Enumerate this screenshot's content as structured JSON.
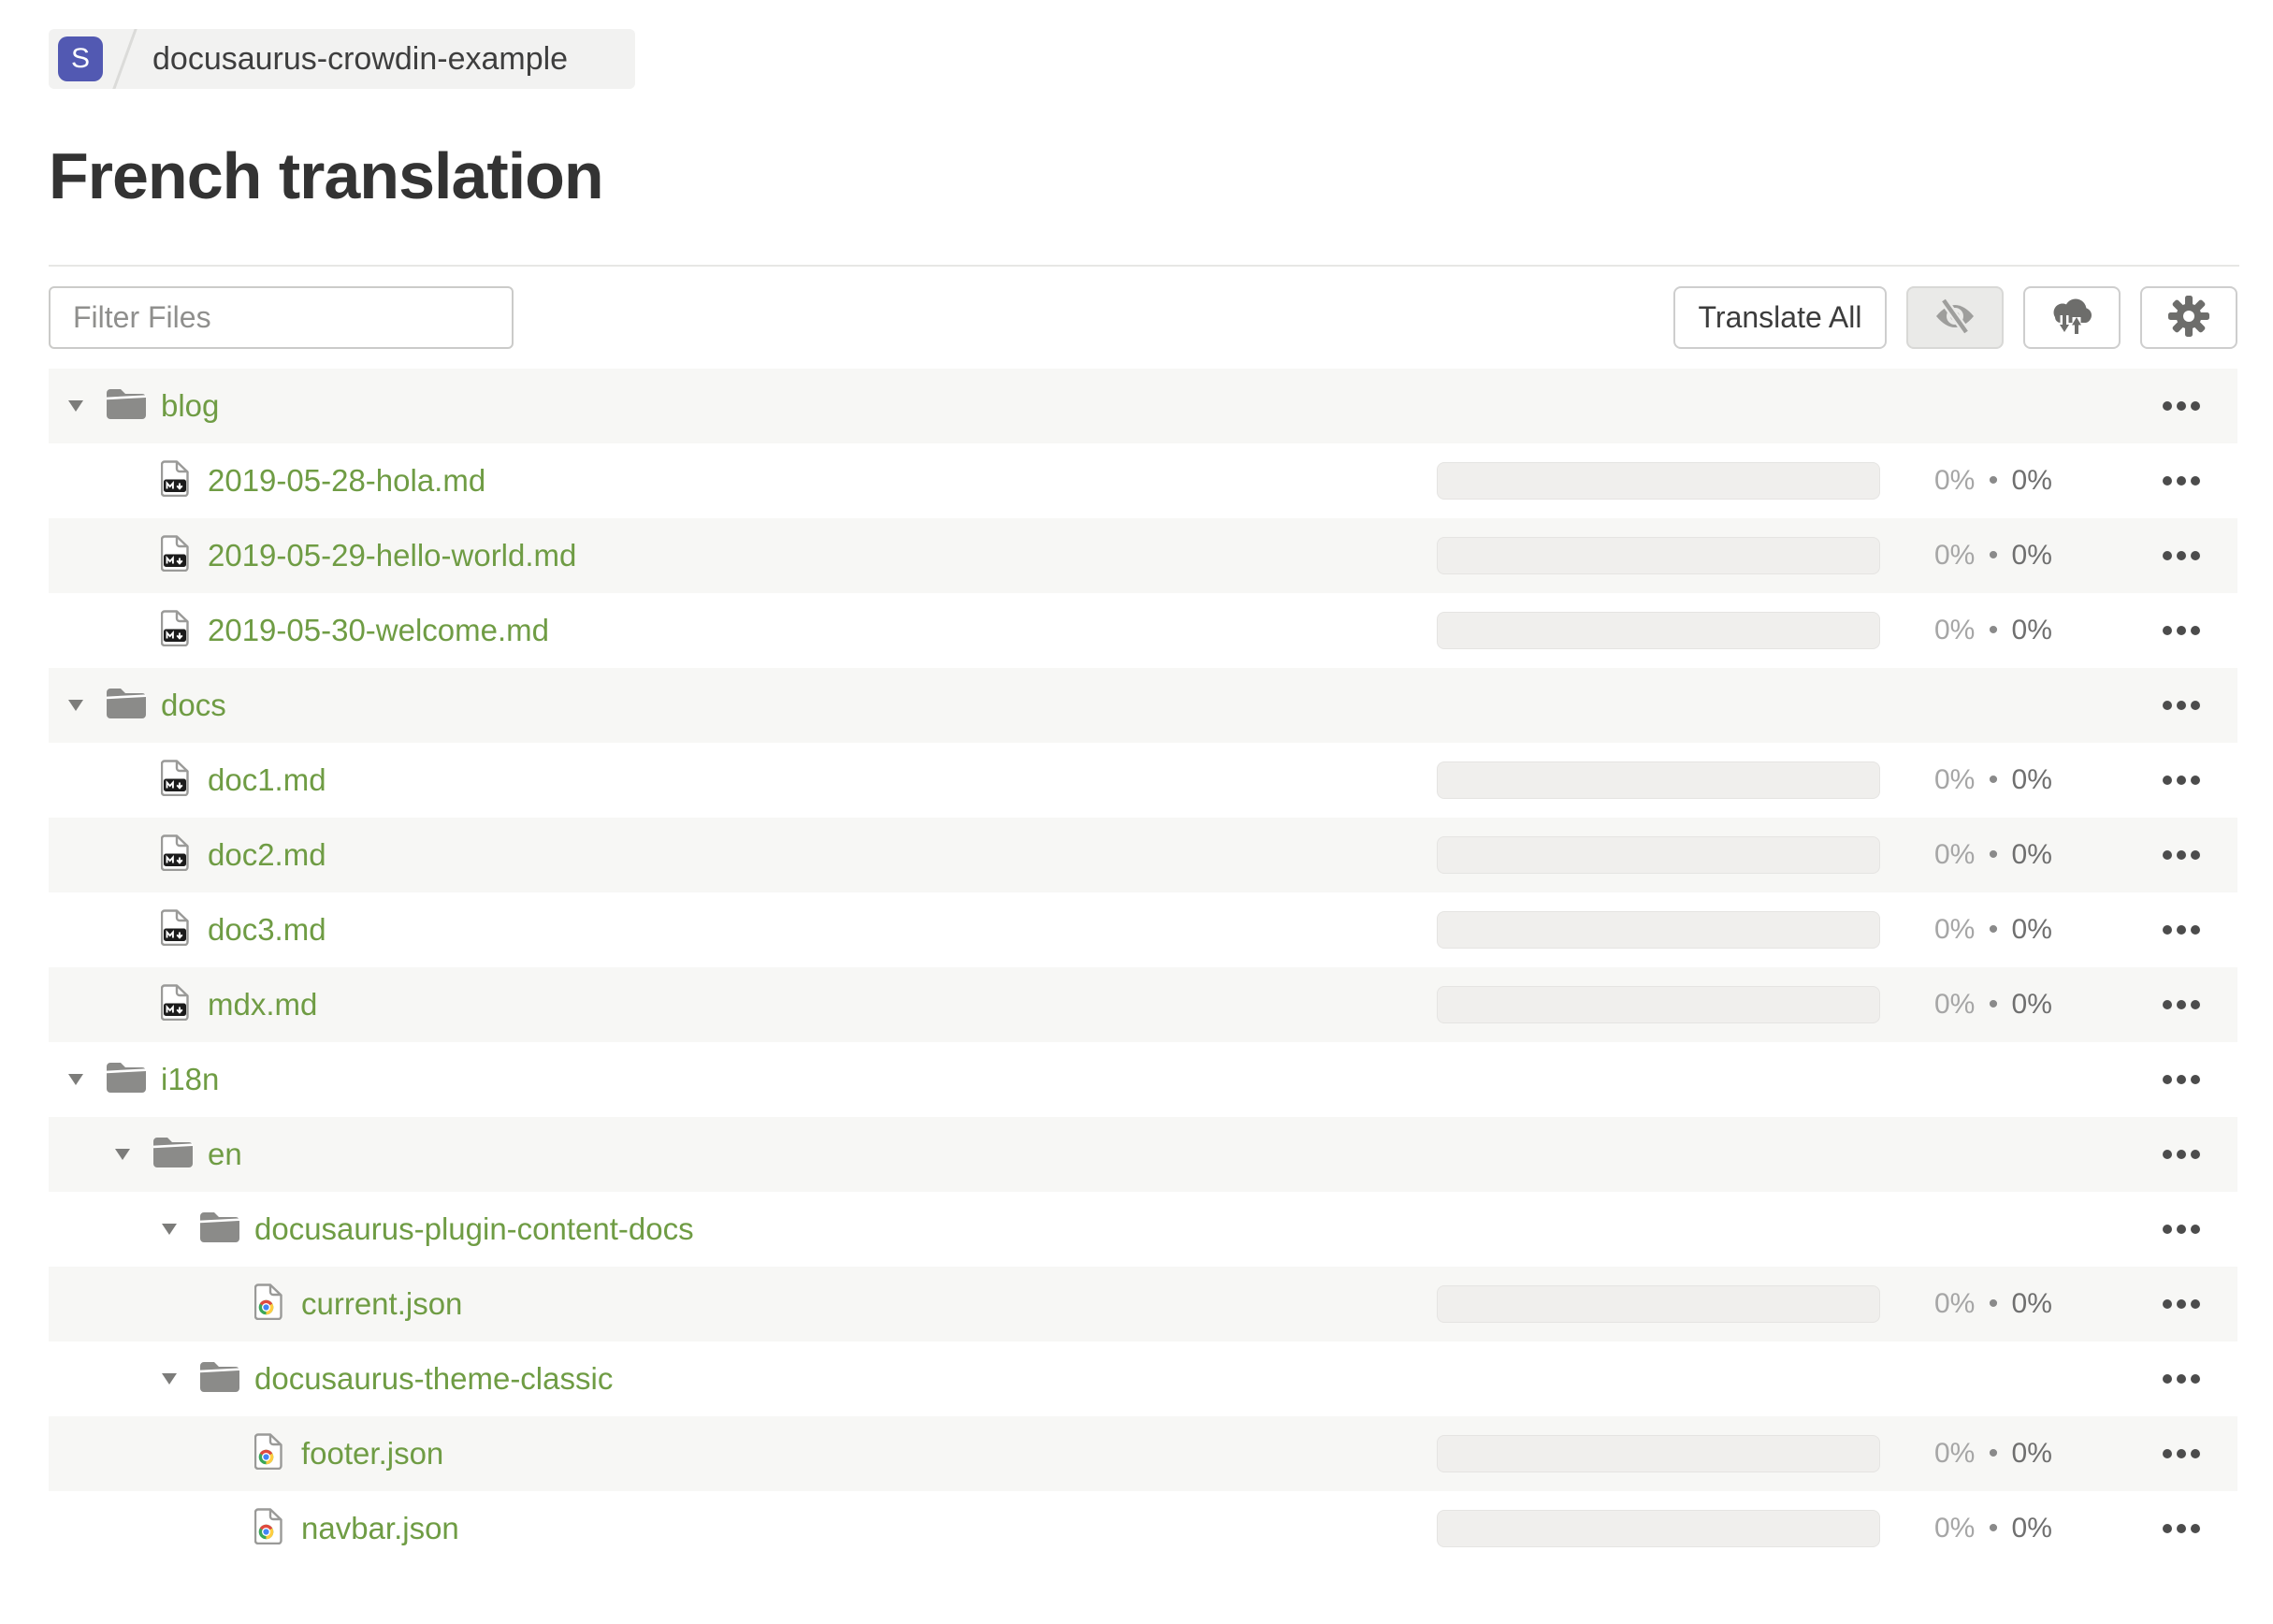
{
  "breadcrumb": {
    "project_initial": "S",
    "project_name": "docusaurus-crowdin-example"
  },
  "page_title": "French translation",
  "toolbar": {
    "filter_placeholder": "Filter Files",
    "translate_all_label": "Translate All",
    "icon_buttons": [
      {
        "name": "hide-completed-button",
        "icon": "eye-off-icon",
        "active": true
      },
      {
        "name": "sync-files-button",
        "icon": "cloud-sync-icon",
        "active": false
      },
      {
        "name": "settings-button",
        "icon": "gear-icon",
        "active": false
      }
    ]
  },
  "colors": {
    "accent_green": "#6f9c44",
    "badge_indigo": "#5259b2",
    "row_stripe": "#f7f7f5",
    "progress_track": "#f0efed",
    "icon_gray": "#8b8b89"
  },
  "file_tree": {
    "separator": "•",
    "rows": [
      {
        "kind": "folder",
        "label": "blog",
        "level": 0
      },
      {
        "kind": "file",
        "label": "2019-05-28-hola.md",
        "level": 1,
        "icon": "markdown-file-icon",
        "translated": "0%",
        "approved": "0%"
      },
      {
        "kind": "file",
        "label": "2019-05-29-hello-world.md",
        "level": 1,
        "icon": "markdown-file-icon",
        "translated": "0%",
        "approved": "0%"
      },
      {
        "kind": "file",
        "label": "2019-05-30-welcome.md",
        "level": 1,
        "icon": "markdown-file-icon",
        "translated": "0%",
        "approved": "0%"
      },
      {
        "kind": "folder",
        "label": "docs",
        "level": 0
      },
      {
        "kind": "file",
        "label": "doc1.md",
        "level": 1,
        "icon": "markdown-file-icon",
        "translated": "0%",
        "approved": "0%"
      },
      {
        "kind": "file",
        "label": "doc2.md",
        "level": 1,
        "icon": "markdown-file-icon",
        "translated": "0%",
        "approved": "0%"
      },
      {
        "kind": "file",
        "label": "doc3.md",
        "level": 1,
        "icon": "markdown-file-icon",
        "translated": "0%",
        "approved": "0%"
      },
      {
        "kind": "file",
        "label": "mdx.md",
        "level": 1,
        "icon": "markdown-file-icon",
        "translated": "0%",
        "approved": "0%"
      },
      {
        "kind": "folder",
        "label": "i18n",
        "level": 0
      },
      {
        "kind": "folder",
        "label": "en",
        "level": 1
      },
      {
        "kind": "folder",
        "label": "docusaurus-plugin-content-docs",
        "level": 2
      },
      {
        "kind": "file",
        "label": "current.json",
        "level": 3,
        "icon": "json-file-icon",
        "translated": "0%",
        "approved": "0%"
      },
      {
        "kind": "folder",
        "label": "docusaurus-theme-classic",
        "level": 2
      },
      {
        "kind": "file",
        "label": "footer.json",
        "level": 3,
        "icon": "json-file-icon",
        "translated": "0%",
        "approved": "0%"
      },
      {
        "kind": "file",
        "label": "navbar.json",
        "level": 3,
        "icon": "json-file-icon",
        "translated": "0%",
        "approved": "0%"
      }
    ]
  }
}
